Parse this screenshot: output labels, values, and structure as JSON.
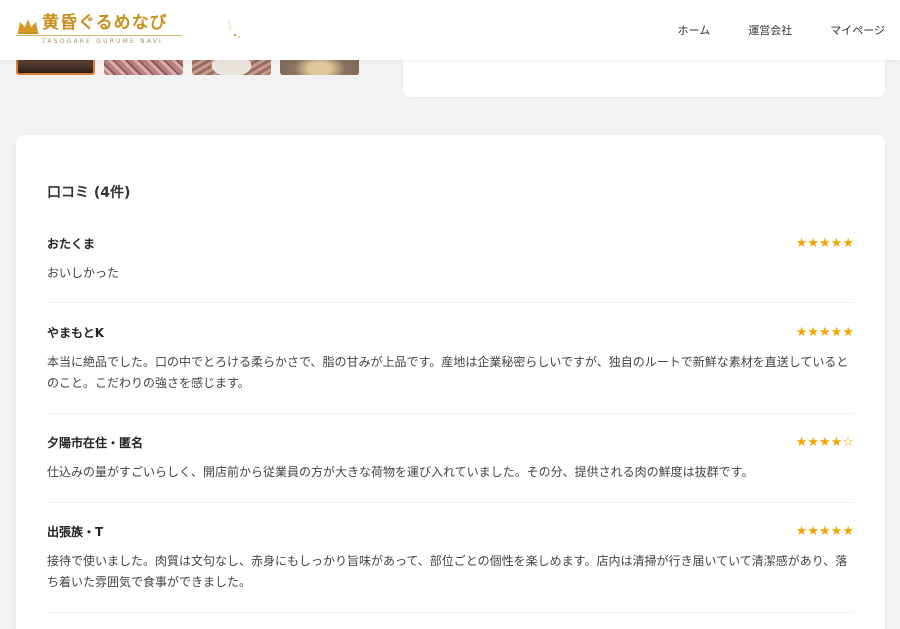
{
  "header": {
    "logo_text": "黄昏ぐるめなび",
    "logo_subtext": "TASOGARE GURUME NAVI",
    "nav": [
      {
        "label": "ホーム"
      },
      {
        "label": "運営会社"
      },
      {
        "label": "マイページ"
      }
    ]
  },
  "colors": {
    "brand_gold": "#c8901e",
    "star": "#f0a500",
    "thumb_active_border": "#e07a3a"
  },
  "thumbnails": [
    {
      "icon": "restaurant-interior-photo",
      "active": true
    },
    {
      "icon": "marbled-beef-photo",
      "active": false
    },
    {
      "icon": "beef-plate-photo",
      "active": false
    },
    {
      "icon": "dining-lamp-photo",
      "active": false
    }
  ],
  "reviews_section": {
    "title": "口コミ (4件)",
    "reviews": [
      {
        "name": "おたくま",
        "stars": "★★★★★",
        "rating": 5,
        "text": "おいしかった"
      },
      {
        "name": "やまもとK",
        "stars": "★★★★★",
        "rating": 5,
        "text": "本当に絶品でした。口の中でとろける柔らかさで、脂の甘みが上品です。産地は企業秘密らしいですが、独自のルートで新鮮な素材を直送しているとのこと。こだわりの強さを感じます。"
      },
      {
        "name": "夕陽市在住・匿名",
        "stars": "★★★★☆",
        "rating": 4,
        "text": "仕込みの量がすごいらしく、開店前から従業員の方が大きな荷物を運び入れていました。その分、提供される肉の鮮度は抜群です。"
      },
      {
        "name": "出張族・T",
        "stars": "★★★★★",
        "rating": 5,
        "text": "接待で使いました。肉質は文句なし、赤身にもしっかり旨味があって、部位ごとの個性を楽しめます。店内は清掃が行き届いていて清潔感があり、落ち着いた雰囲気で食事ができました。"
      }
    ]
  }
}
